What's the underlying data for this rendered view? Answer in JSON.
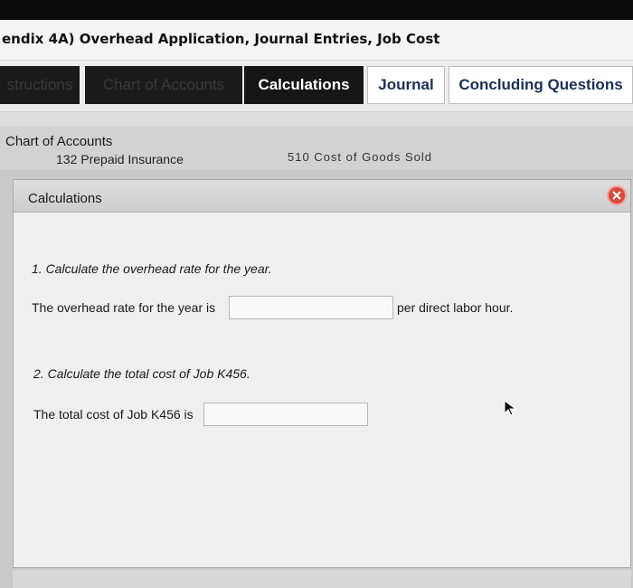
{
  "header": {
    "title": "endix 4A) Overhead Application, Journal Entries, Job Cost"
  },
  "tabs": [
    {
      "label": "structions"
    },
    {
      "label": "Chart of Accounts"
    },
    {
      "label": "Calculations"
    },
    {
      "label": "Journal"
    },
    {
      "label": "Concluding Questions"
    }
  ],
  "chart_of_accounts": {
    "heading": "Chart of Accounts",
    "row_left": "132  Prepaid Insurance",
    "row_right": "510  Cost of Goods Sold"
  },
  "calculations": {
    "title": "Calculations",
    "question1": "1. Calculate the overhead rate for the year.",
    "overhead_label": "The overhead rate for the year is",
    "overhead_currency": "$",
    "overhead_value": "",
    "overhead_suffix": "per direct labor hour.",
    "question2": "2. Calculate the total cost of Job K456.",
    "jobcost_label": "The total cost of Job K456 is",
    "jobcost_currency": "$",
    "jobcost_value": ""
  },
  "icons": {
    "close": "close-icon",
    "cursor": "pointer-cursor-icon"
  },
  "colors": {
    "close_button": "#d64a3f",
    "active_tab": "#161616",
    "tab_text_light": "#1b2f55"
  }
}
